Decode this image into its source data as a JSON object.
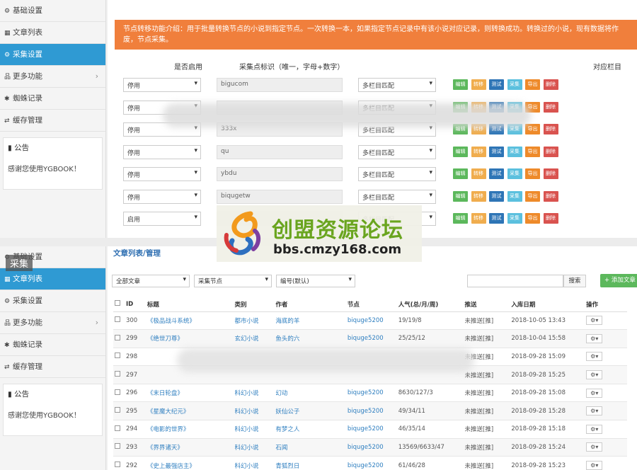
{
  "top": {
    "sidebar": [
      {
        "label": "基础设置",
        "icon": "gear-icon",
        "glyph": "⚙"
      },
      {
        "label": "文章列表",
        "icon": "table-icon",
        "glyph": "▦"
      },
      {
        "label": "采集设置",
        "icon": "cogs-icon",
        "glyph": "⚙"
      },
      {
        "label": "更多功能",
        "icon": "sitemap-icon",
        "glyph": "品"
      },
      {
        "label": "蜘蛛记录",
        "icon": "bug-icon",
        "glyph": "✱"
      },
      {
        "label": "缓存管理",
        "icon": "retweet-icon",
        "glyph": "⇄"
      }
    ],
    "notice_title": "公告",
    "notice_text": "感谢您使用YGBOOK！",
    "info": "节点转移功能介绍：用于批量转换节点的小说到指定节点。一次转换一本，如果指定节点记录中有该小说对应记录，则转换成功。转换过的小说，现有数据将作废，节点采集。",
    "headers": {
      "enable": "是否启用",
      "ident": "采集点标识（唯一，字母+数字）",
      "column": "对应栏目"
    },
    "rows": [
      {
        "enable": "停用",
        "ident": "bigucom",
        "match": "多栏目匹配"
      },
      {
        "enable": "停用",
        "ident": "",
        "match": "多栏目匹配"
      },
      {
        "enable": "停用",
        "ident": "333x",
        "match": "多栏目匹配"
      },
      {
        "enable": "停用",
        "ident": "qu",
        "match": "多栏目匹配"
      },
      {
        "enable": "停用",
        "ident": "ybdu",
        "match": "多栏目匹配"
      },
      {
        "enable": "停用",
        "ident": "biqugetw",
        "match": "多栏目匹配"
      },
      {
        "enable": "启用",
        "ident": "",
        "match": "多栏目匹配"
      }
    ],
    "actions": [
      "编辑",
      "转移",
      "测试",
      "采集",
      "导出",
      "删除"
    ]
  },
  "watermark": {
    "title": "创盟资源论坛",
    "url": "bbs.cmzy168.com"
  },
  "caiji_label": "采集",
  "bottom": {
    "title": "文章列表/管理",
    "sidebar": [
      {
        "label": "基础设置",
        "icon": "gear-icon",
        "glyph": "⚙"
      },
      {
        "label": "文章列表",
        "icon": "table-icon",
        "glyph": "▦"
      },
      {
        "label": "采集设置",
        "icon": "cogs-icon",
        "glyph": "⚙"
      },
      {
        "label": "更多功能",
        "icon": "sitemap-icon",
        "glyph": "品"
      },
      {
        "label": "蜘蛛记录",
        "icon": "bug-icon",
        "glyph": "✱"
      },
      {
        "label": "缓存管理",
        "icon": "retweet-icon",
        "glyph": "⇄"
      }
    ],
    "notice_title": "公告",
    "notice_text": "感谢您使用YGBOOK！",
    "filters": [
      "全部文章",
      "采集节点",
      "编号(默认)"
    ],
    "search_label": "搜索",
    "add_label": "+ 添加文章",
    "columns": [
      "ID",
      "标题",
      "类别",
      "作者",
      "节点",
      "人气(总/月/周)",
      "推送",
      "入库日期",
      "操作"
    ],
    "rows": [
      {
        "id": "300",
        "title": "《极品战斗系统》",
        "cat": "都市小说",
        "author": "海底的羊",
        "node": "biquge5200",
        "pop": "19/19/8",
        "push": "未推送[推]",
        "date": "2018-10-05 13:43"
      },
      {
        "id": "299",
        "title": "《绝世刀尊》",
        "cat": "玄幻小说",
        "author": "鱼头的六",
        "node": "biquge5200",
        "pop": "25/25/12",
        "push": "未推送[推]",
        "date": "2018-10-04 15:58"
      },
      {
        "id": "298",
        "title": "",
        "cat": "",
        "author": "",
        "node": "",
        "pop": "",
        "push": "未推送[推]",
        "date": "2018-09-28 15:09"
      },
      {
        "id": "297",
        "title": "",
        "cat": "",
        "author": "",
        "node": "",
        "pop": "",
        "push": "未推送[推]",
        "date": "2018-09-28 15:25"
      },
      {
        "id": "296",
        "title": "《末日轮盘》",
        "cat": "科幻小说",
        "author": "幻动",
        "node": "biquge5200",
        "pop": "8630/127/3",
        "push": "未推送[推]",
        "date": "2018-09-28 15:08"
      },
      {
        "id": "295",
        "title": "《星魔大纪元》",
        "cat": "科幻小说",
        "author": "妖仙公子",
        "node": "biquge5200",
        "pop": "49/34/11",
        "push": "未推送[推]",
        "date": "2018-09-28 15:28"
      },
      {
        "id": "294",
        "title": "《电影的世界》",
        "cat": "科幻小说",
        "author": "有梦之人",
        "node": "biquge5200",
        "pop": "46/35/14",
        "push": "未推送[推]",
        "date": "2018-09-28 15:18"
      },
      {
        "id": "293",
        "title": "《界界诸天》",
        "cat": "科幻小说",
        "author": "石闻",
        "node": "biquge5200",
        "pop": "13569/6633/47",
        "push": "未推送[推]",
        "date": "2018-09-28 15:24"
      },
      {
        "id": "292",
        "title": "《史上最强店主》",
        "cat": "科幻小说",
        "author": "青狐烈日",
        "node": "biquge5200",
        "pop": "61/46/28",
        "push": "未推送[推]",
        "date": "2018-09-28 15:23"
      }
    ]
  }
}
